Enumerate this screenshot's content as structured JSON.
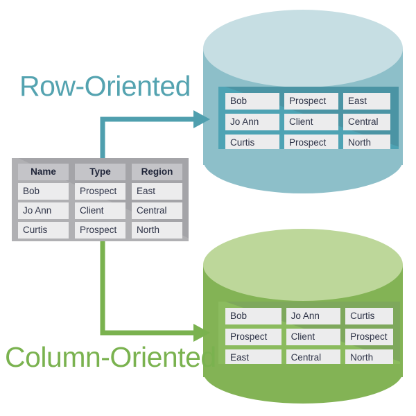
{
  "labels": {
    "row_oriented": "Row-Oriented",
    "column_oriented": "Column-Oriented"
  },
  "colors": {
    "row_accent": "#54a3b0",
    "column_accent": "#7ab24f",
    "blue_cylinder_body": "#8dbfc9",
    "blue_cylinder_top": "#c6dee3",
    "green_cylinder_body": "#83b355",
    "green_cylinder_top": "#bdd79a",
    "blue_panel": "#4ea3b4",
    "green_panel": "#8bbb5e",
    "source_panel": "#b0b0b3",
    "cell_background": "#ececed",
    "header_background": "#c4c4c8",
    "text": "#2e3347"
  },
  "source_table": {
    "headers": [
      "Name",
      "Type",
      "Region"
    ],
    "rows": [
      [
        "Bob",
        "Prospect",
        "East"
      ],
      [
        "Jo Ann",
        "Client",
        "Central"
      ],
      [
        "Curtis",
        "Prospect",
        "North"
      ]
    ]
  },
  "row_store": {
    "rows": [
      [
        "Bob",
        "Prospect",
        "East"
      ],
      [
        "Jo Ann",
        "Client",
        "Central"
      ],
      [
        "Curtis",
        "Prospect",
        "North"
      ]
    ]
  },
  "column_store": {
    "rows": [
      [
        "Bob",
        "Jo Ann",
        "Curtis"
      ],
      [
        "Prospect",
        "Client",
        "Prospect"
      ],
      [
        "East",
        "Central",
        "North"
      ]
    ]
  },
  "arrows": {
    "row_arrow": "arrow-to-row-store",
    "column_arrow": "arrow-to-column-store"
  }
}
